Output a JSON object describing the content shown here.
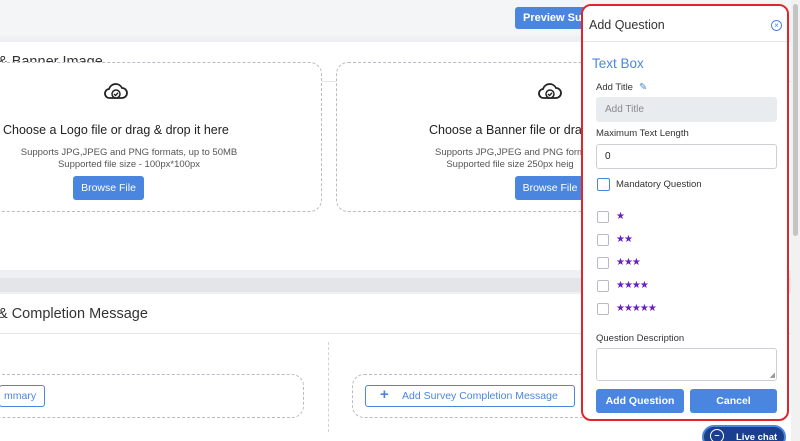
{
  "header": {
    "preview_label": "Preview Sur"
  },
  "logo_section": {
    "title": "& Banner Image",
    "logo": {
      "icon": "cloud-upload-icon",
      "title": "Choose a Logo file or drag & drop it here",
      "line1": "Supports JPG,JPEG and PNG formats, up to 50MB",
      "line2": "Supported file size - 100px*100px",
      "button": "Browse File"
    },
    "banner": {
      "icon": "cloud-upload-icon",
      "title": "Choose a Banner file or drag",
      "line1": "Supports JPG,JPEG and PNG form",
      "line2": "Supported file size 250px heig",
      "button": "Browse File"
    }
  },
  "completion_section": {
    "title": "& Completion Message",
    "summary_button": "mmary",
    "completion_button": "Add Survey Completion Message",
    "completion_icon": "plus-icon"
  },
  "panel": {
    "title": "Add Question",
    "close_icon": "close-circle-icon",
    "question_type": "Text Box",
    "add_title_label": "Add Title",
    "edit_icon": "pencil-icon",
    "title_placeholder": "Add Title",
    "max_length_label": "Maximum Text Length",
    "max_length_value": "0",
    "mandatory_label": "Mandatory Question",
    "ratings": [
      "★",
      "★★",
      "★★★",
      "★★★★",
      "★★★★★"
    ],
    "description_label": "Question Description",
    "add_button": "Add Question",
    "cancel_button": "Cancel"
  },
  "livechat": {
    "label": "Live chat",
    "icon": "chat-icon"
  },
  "colors": {
    "accent": "#4a86e0",
    "highlight": "#e0262b",
    "star": "#6a1fc2"
  }
}
